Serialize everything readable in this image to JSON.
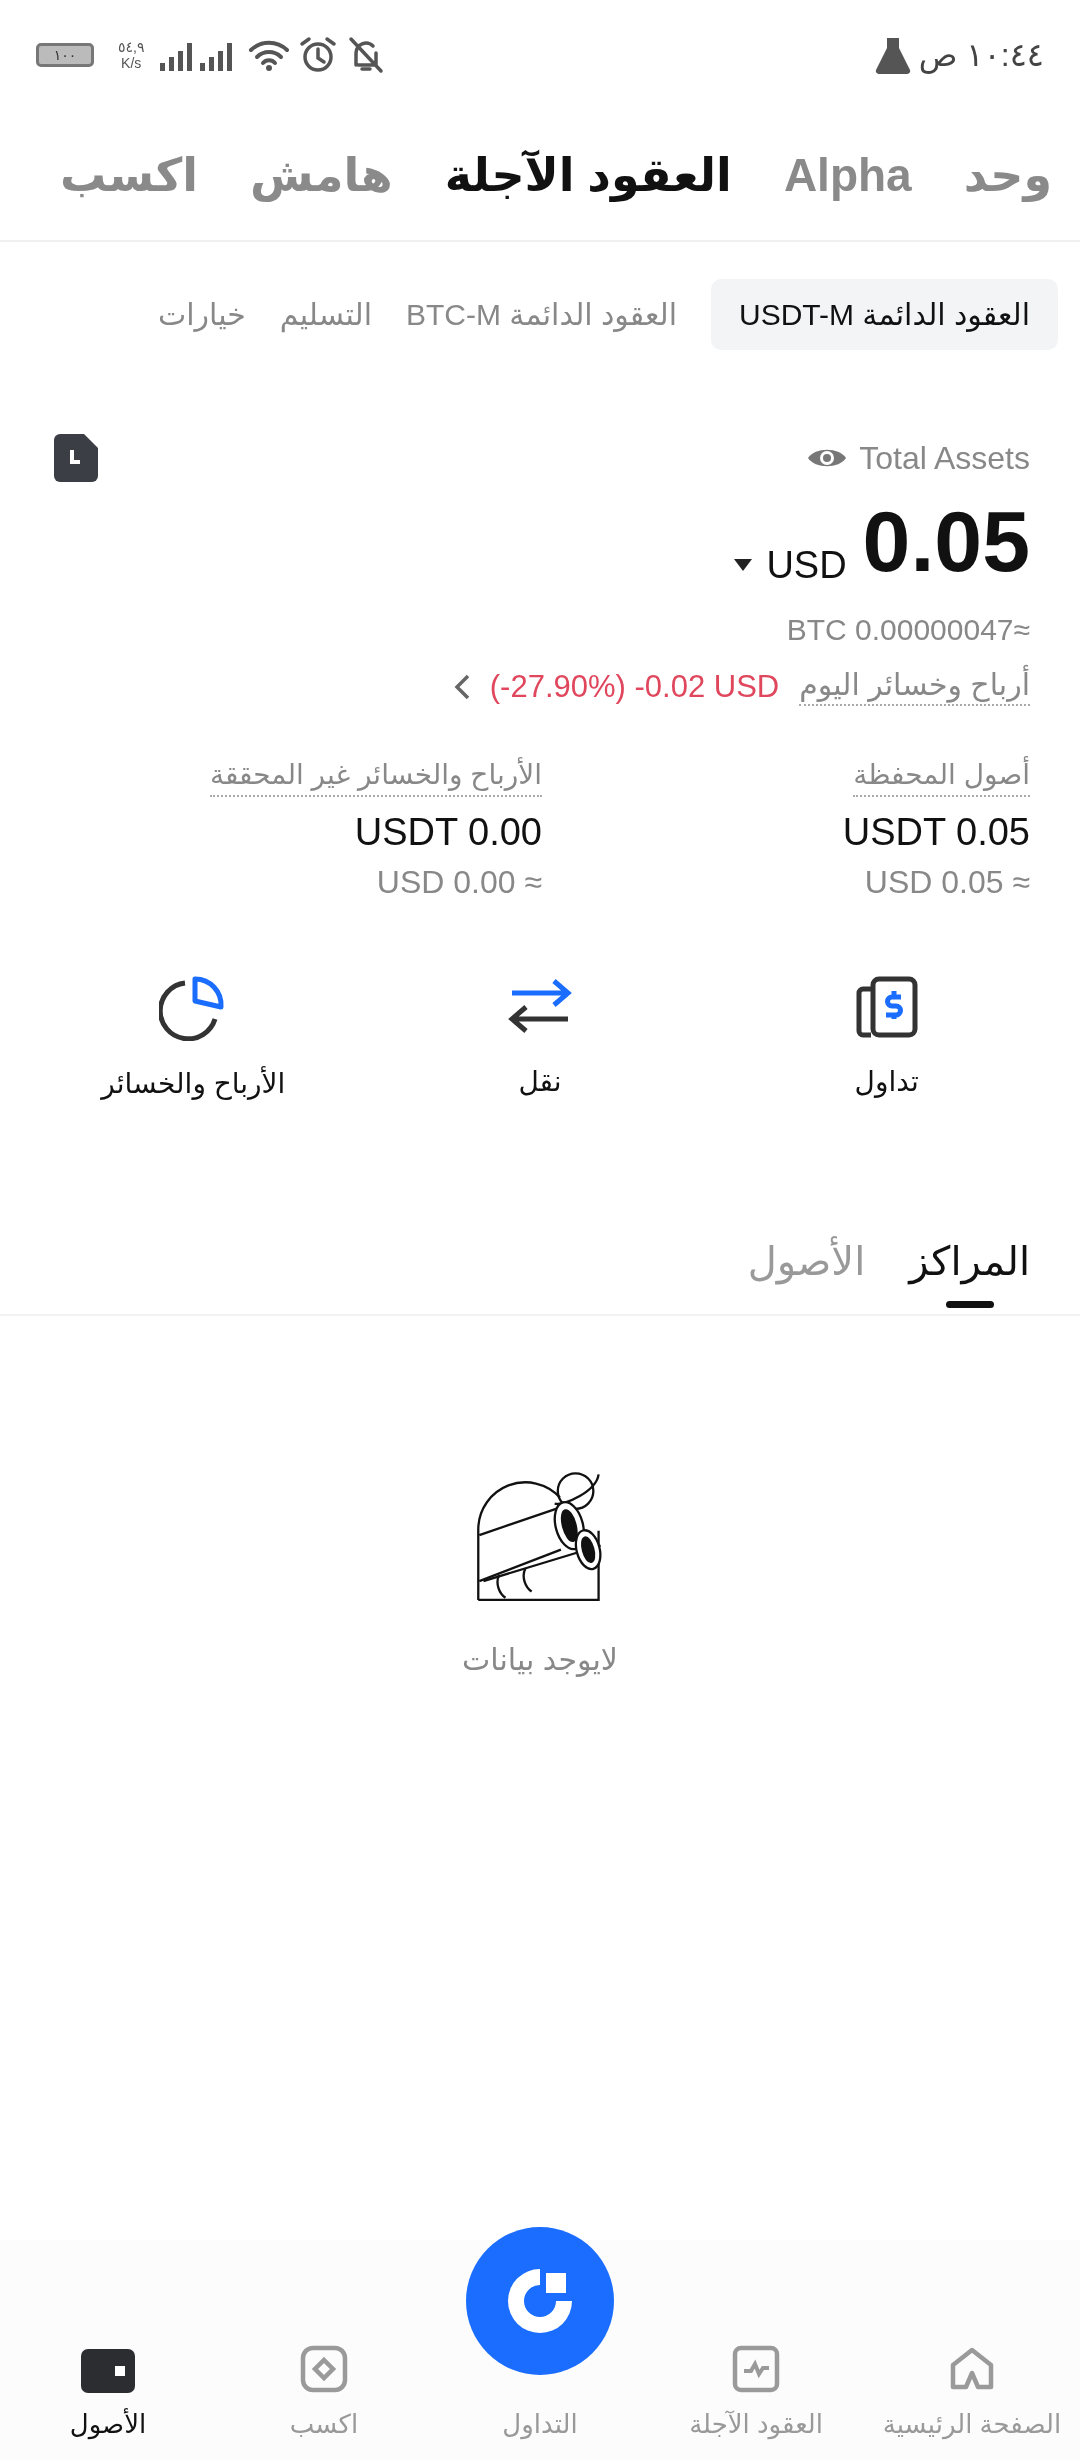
{
  "status_bar": {
    "time": "١٠:٤٤ ص",
    "net_speed": "٥٤,٩",
    "net_unit": "K/s",
    "battery": "١٠٠"
  },
  "top_tabs": [
    {
      "label": "وحد",
      "selected": false
    },
    {
      "label": "Alpha",
      "selected": false
    },
    {
      "label": "العقود الآجلة",
      "selected": true
    },
    {
      "label": "هامش",
      "selected": false
    },
    {
      "label": "اكسب",
      "selected": false
    }
  ],
  "sub_tabs": [
    {
      "label": "العقود الدائمة USDT-M",
      "selected": true
    },
    {
      "label": "العقود الدائمة BTC-M",
      "selected": false
    },
    {
      "label": "التسليم",
      "selected": false
    },
    {
      "label": "خيارات",
      "selected": false
    }
  ],
  "assets": {
    "title": "Total Assets",
    "amount": "0.05",
    "currency": "USD",
    "btc": "BTC 0.00000047≈",
    "pnl_label": "أرباح وخسائر اليوم",
    "pnl_value": "(-27.90%) -0.02 USD"
  },
  "stats": [
    {
      "label": "أصول المحفظة",
      "value": "USDT 0.05",
      "approx": "USD 0.05 ≈"
    },
    {
      "label": "الأرباح والخسائر غير المحققة",
      "value": "USDT 0.00",
      "approx": "USD 0.00 ≈"
    }
  ],
  "actions": [
    {
      "label": "تداول",
      "kind": "trade"
    },
    {
      "label": "نقل",
      "kind": "transfer"
    },
    {
      "label": "الأرباح والخسائر",
      "kind": "pnl"
    }
  ],
  "position_tabs": [
    {
      "label": "المراكز",
      "selected": true
    },
    {
      "label": "الأصول",
      "selected": false
    }
  ],
  "empty_state": {
    "message": "لايوجد بيانات"
  },
  "bottom_nav": [
    {
      "label": "الصفحة الرئيسية",
      "kind": "home",
      "selected": false
    },
    {
      "label": "العقود الآجلة",
      "kind": "futures",
      "selected": false
    },
    {
      "label": "التداول",
      "kind": "trade",
      "selected": false
    },
    {
      "label": "اكسب",
      "kind": "earn",
      "selected": false
    },
    {
      "label": "الأصول",
      "kind": "assets",
      "selected": true
    }
  ]
}
